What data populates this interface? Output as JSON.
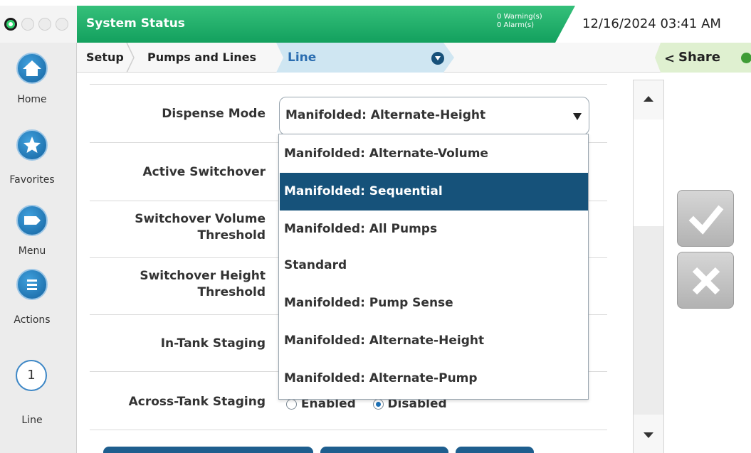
{
  "app": {
    "status_title": "System Status",
    "warnings": "0 Warning(s)",
    "alarms": "0 Alarm(s)",
    "datetime": "12/16/2024 03:41 AM"
  },
  "breadcrumb": {
    "items": [
      "Setup",
      "Pumps and Lines",
      "Line"
    ],
    "share_label": "Share"
  },
  "nav": {
    "home": "Home",
    "favorites": "Favorites",
    "menu": "Menu",
    "actions": "Actions",
    "line_number": "1",
    "line": "Line"
  },
  "form": {
    "dispense_mode_label": "Dispense Mode",
    "dispense_mode_value": "Manifolded: Alternate-Height",
    "active_switchover_label": "Active Switchover",
    "switchover_volume_label_1": "Switchover Volume",
    "switchover_volume_label_2": "Threshold",
    "switchover_height_label_1": "Switchover Height",
    "switchover_height_label_2": "Threshold",
    "in_tank_staging_label": "In-Tank Staging",
    "across_tank_staging_label": "Across-Tank Staging",
    "enabled": "Enabled",
    "disabled": "Disabled"
  },
  "dropdown": {
    "options": [
      "Manifolded: Alternate-Volume",
      "Manifolded: Sequential",
      "Manifolded: All Pumps",
      "Standard",
      "Manifolded: Pump Sense",
      "Manifolded: Alternate-Height",
      "Manifolded: Alternate-Pump"
    ],
    "selected_option": "Manifolded: Sequential"
  },
  "colors": {
    "status_green": "#13a05e",
    "nav_blue": "#15639f",
    "selected_option": "#16527a",
    "breadcrumb_line": "#cfe6f2",
    "share_green": "#dff0d0"
  },
  "icons": {
    "home": "home-icon",
    "favorites": "star-icon",
    "menu": "tag-icon",
    "actions": "list-icon",
    "share": "share-icon",
    "accept": "check-icon",
    "cancel": "x-icon"
  }
}
